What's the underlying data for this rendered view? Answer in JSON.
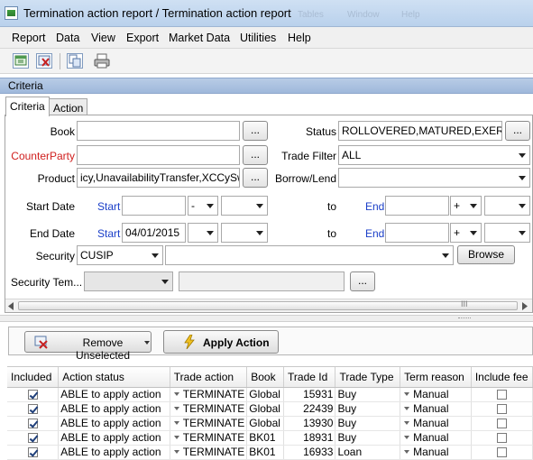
{
  "window": {
    "title": "Termination action report / Termination action report",
    "ghost_left": "Tables",
    "ghost_right": "Window",
    "ghost_help": "Help"
  },
  "menu": [
    "Report",
    "Data",
    "View",
    "Export",
    "Market Data",
    "Utilities",
    "Help"
  ],
  "toolbar_icons": [
    "new-report-icon",
    "delete-report-icon",
    "copy-icon",
    "print-icon"
  ],
  "criteria": {
    "header": "Criteria",
    "tabs": [
      "Criteria",
      "Action"
    ],
    "book_label": "Book",
    "book_value": "",
    "counterparty_label": "CounterParty",
    "counterparty_value": "",
    "product_label": "Product",
    "product_value": "icy,UnavailabilityTransfer,XCCySwap",
    "status_label": "Status",
    "status_value": "ROLLOVERED,MATURED,EXERCISED",
    "trade_filter_label": "Trade Filter",
    "trade_filter_value": "ALL",
    "borrow_lend_label": "Borrow/Lend",
    "borrow_lend_value": "",
    "start_date_label": "Start Date",
    "end_date_label": "End Date",
    "start_label": "Start",
    "to_label": "to",
    "end_label": "End",
    "start_date_from": "",
    "start_date_op": "-",
    "end_date_from": "04/01/2015",
    "end_date_op": "",
    "start_date_to_op": "+",
    "end_date_to_op": "+",
    "security_label": "Security",
    "security_type": "CUSIP",
    "security_value": "",
    "browse_label": "Browse",
    "security_template_label": "Security Tem...",
    "dots": "...",
    "scroll_grip": "III"
  },
  "actions": {
    "remove_unselected": "Remove Unselected",
    "apply_action": "Apply Action"
  },
  "grid": {
    "columns": [
      "Included",
      "Action status",
      "Trade action",
      "Book",
      "Trade Id",
      "Trade Type",
      "Term reason",
      "Include fee"
    ],
    "rows": [
      {
        "included": true,
        "status": "ABLE to apply action",
        "action": "TERMINATE",
        "book": "Global",
        "trade_id": "15931",
        "type": "Buy",
        "reason": "Manual",
        "fee": false
      },
      {
        "included": true,
        "status": "ABLE to apply action",
        "action": "TERMINATE",
        "book": "Global",
        "trade_id": "22439",
        "type": "Buy",
        "reason": "Manual",
        "fee": false
      },
      {
        "included": true,
        "status": "ABLE to apply action",
        "action": "TERMINATE",
        "book": "Global",
        "trade_id": "13930",
        "type": "Buy",
        "reason": "Manual",
        "fee": false
      },
      {
        "included": true,
        "status": "ABLE to apply action",
        "action": "TERMINATE",
        "book": "BK01",
        "trade_id": "18931",
        "type": "Buy",
        "reason": "Manual",
        "fee": false
      },
      {
        "included": true,
        "status": "ABLE to apply action",
        "action": "TERMINATE",
        "book": "BK01",
        "trade_id": "16933",
        "type": "Loan",
        "reason": "Manual",
        "fee": false
      }
    ]
  }
}
